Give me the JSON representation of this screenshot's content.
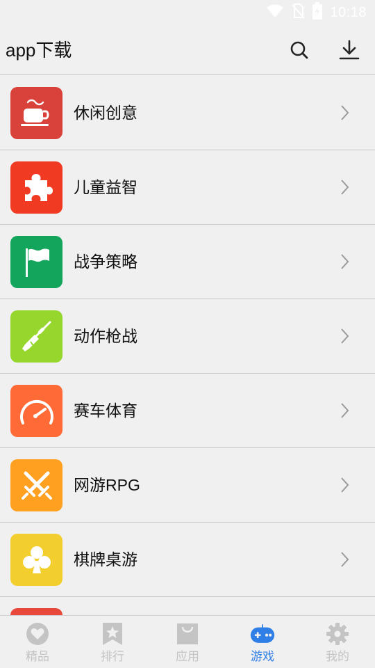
{
  "status_bar": {
    "time": "10:18",
    "icons": [
      "wifi-icon",
      "no-sim-icon",
      "battery-charging-icon"
    ]
  },
  "header": {
    "title": "app下载",
    "search_icon": "search-icon",
    "download_icon": "download-icon"
  },
  "categories": [
    {
      "label": "休闲创意",
      "icon": "coffee-cup-icon",
      "color": "#d9423a"
    },
    {
      "label": "儿童益智",
      "icon": "puzzle-icon",
      "color": "#f03a22"
    },
    {
      "label": "战争策略",
      "icon": "flag-icon",
      "color": "#12a55b"
    },
    {
      "label": "动作枪战",
      "icon": "rifle-icon",
      "color": "#96d62d"
    },
    {
      "label": "赛车体育",
      "icon": "speedometer-icon",
      "color": "#ff6a36"
    },
    {
      "label": "网游RPG",
      "icon": "crossed-swords-icon",
      "color": "#ffa020"
    },
    {
      "label": "棋牌桌游",
      "icon": "club-icon",
      "color": "#f2cf2e"
    }
  ],
  "bottom_nav": {
    "active_tab": "游戏",
    "active_color": "#2f7fe6",
    "inactive_color": "#c4c4c4",
    "tabs": [
      {
        "label": "精品",
        "icon": "heart-icon"
      },
      {
        "label": "排行",
        "icon": "ranking-star-icon"
      },
      {
        "label": "应用",
        "icon": "shopping-bag-icon"
      },
      {
        "label": "游戏",
        "icon": "gamepad-icon"
      },
      {
        "label": "我的",
        "icon": "gear-icon"
      }
    ]
  }
}
